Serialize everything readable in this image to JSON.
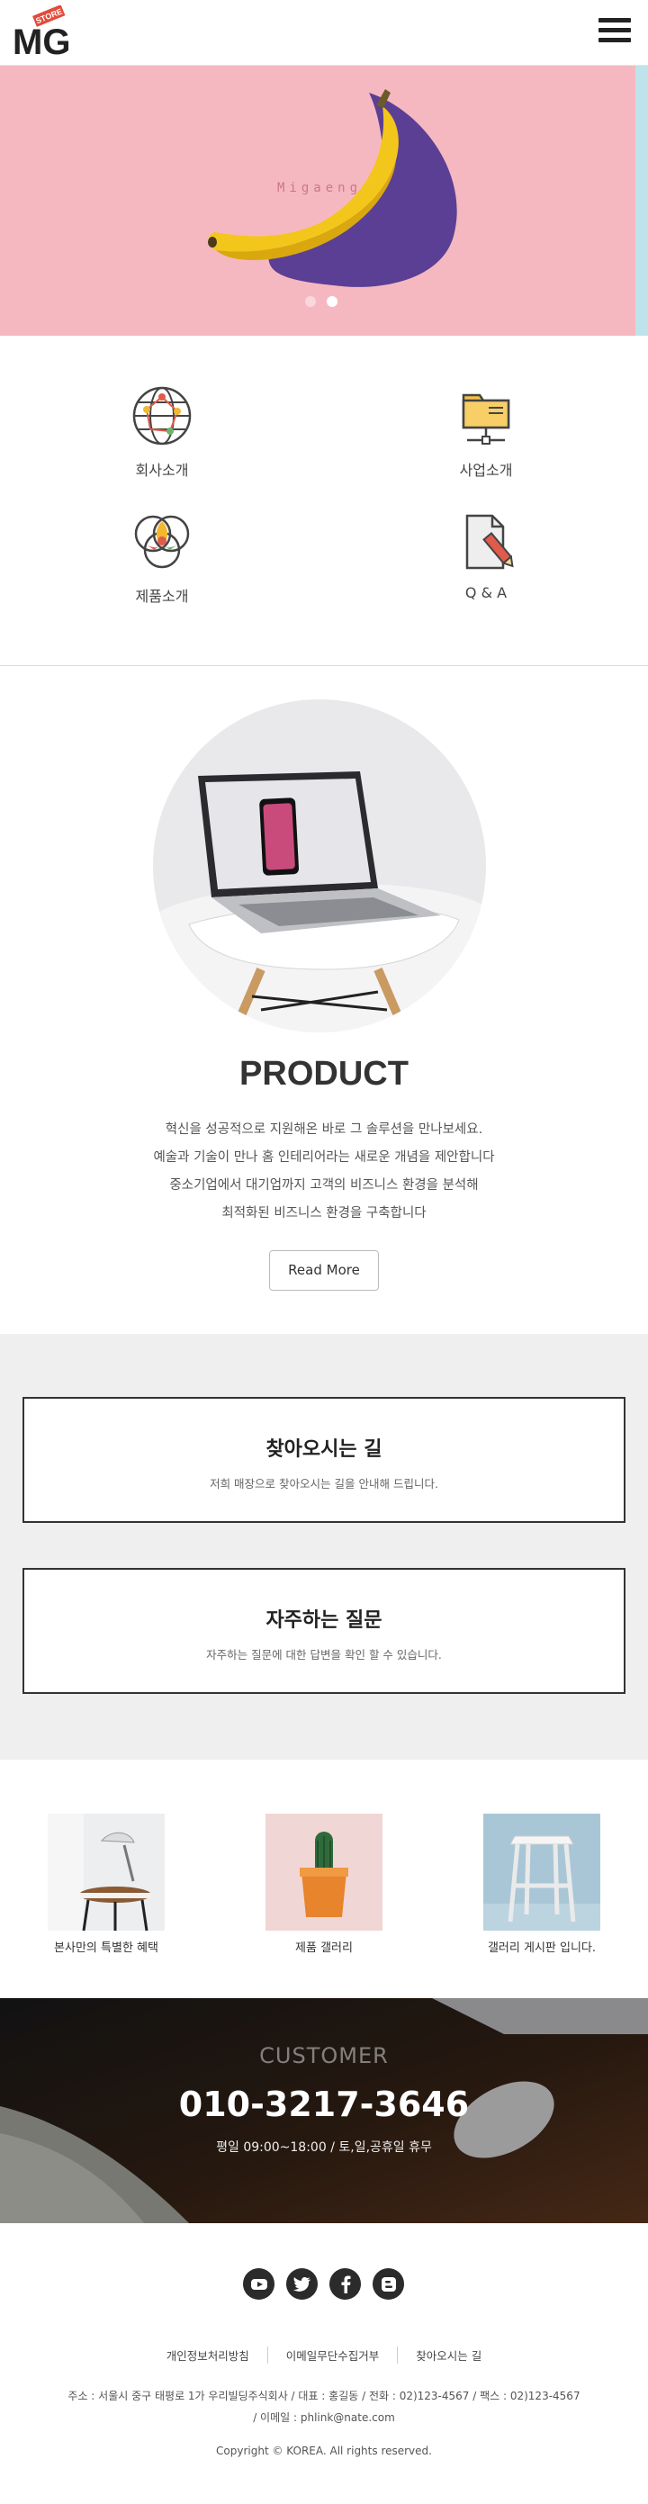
{
  "header": {
    "logo_text": "MG",
    "logo_badge": "STORE",
    "menu_icon": "hamburger-icon"
  },
  "hero": {
    "watermark": "Migaeng",
    "slide_count": 2,
    "active_slide": 2,
    "colors": {
      "background": "#f6b8c0",
      "shadow": "#5b3f94",
      "banana": "#f3c61b"
    }
  },
  "quick_menu": {
    "items": [
      {
        "label": "회사소개",
        "icon": "globe-icon"
      },
      {
        "label": "사업소개",
        "icon": "folder-network-icon"
      },
      {
        "label": "제품소개",
        "icon": "venn-diagram-icon"
      },
      {
        "label": "Q & A",
        "icon": "document-pencil-icon"
      }
    ]
  },
  "product": {
    "title": "PRODUCT",
    "lines": [
      "혁신을 성공적으로 지원해온 바로 그 솔루션을 만나보세요.",
      "예술과 기술이 만나 홈 인테리어라는 새로운 개념을 제안합니다",
      "중소기업에서 대기업까지 고객의 비즈니스 환경을 분석해",
      "최적화된 비즈니스 환경을 구축합니다"
    ],
    "button_label": "Read More"
  },
  "info_boxes": [
    {
      "title": "찾아오시는 길",
      "subtitle": "저희 매장으로 찾아오시는 길을 안내해 드립니다."
    },
    {
      "title": "자주하는 질문",
      "subtitle": "자주하는 질문에 대한 답변을 확인 할 수 있습니다."
    }
  ],
  "gallery": [
    {
      "label": "본사만의 특별한 혜택"
    },
    {
      "label": "제품 갤러리"
    },
    {
      "label": "갤러리 게시판 입니다."
    }
  ],
  "customer": {
    "label": "CUSTOMER",
    "phone": "010-3217-3646",
    "hours": "평일 09:00~18:00 / 토,일,공휴일 휴무"
  },
  "footer": {
    "socials": [
      "youtube-icon",
      "twitter-icon",
      "facebook-icon",
      "blogger-icon"
    ],
    "links": [
      "개인정보처리방침",
      "이메일무단수집거부",
      "찾아오시는 길"
    ],
    "address_line": "주소 : 서울시 중구 태평로 1가 우리빌딩주식회사   /   대표 : 홍길동   /   전화 : 02)123-4567   /   팩스 : 02)123-4567",
    "email_line": "/   이메일 : phlink@nate.com",
    "copyright": "Copyright © KOREA. All rights reserved."
  }
}
